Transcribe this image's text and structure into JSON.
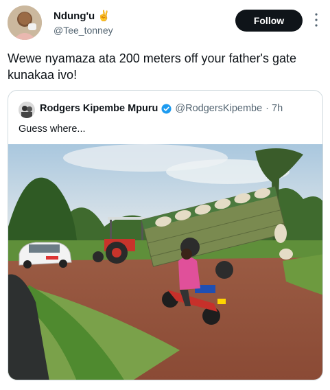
{
  "author": {
    "display_name": "Ndung'u",
    "emoji": "✌",
    "handle": "@Tee_tonney"
  },
  "follow_label": "Follow",
  "tweet": {
    "text_line1": "Wewe nyamaza ata 200 meters off your father's gate",
    "text_line2": "kunakaa ivo!"
  },
  "quoted": {
    "display_name": "Rodgers Kipembe Mpuru",
    "handle": "@RodgersKipembe",
    "time": "· 7h",
    "text": "Guess where...",
    "photo_icon": "overturned-trailer-photo"
  },
  "colors": {
    "follow_bg": "#0f1419",
    "verified": "#1d9bf0",
    "secondary_text": "#536471"
  }
}
